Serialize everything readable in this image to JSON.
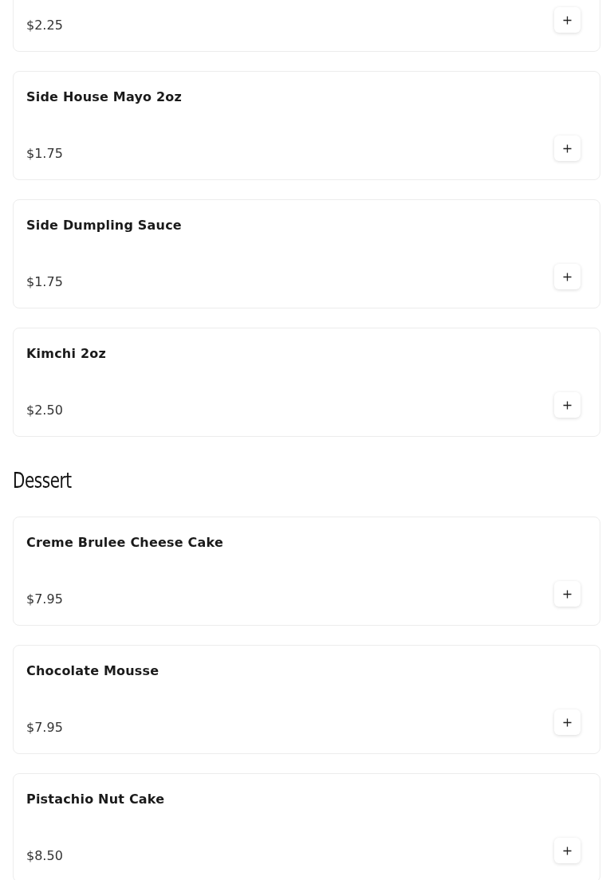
{
  "sections": [
    {
      "items": [
        {
          "price": "$2.25"
        },
        {
          "name": "Side House Mayo 2oz",
          "price": "$1.75"
        },
        {
          "name": "Side Dumpling Sauce",
          "price": "$1.75"
        },
        {
          "name": "Kimchi 2oz",
          "price": "$2.50"
        }
      ]
    },
    {
      "heading": "Dessert",
      "items": [
        {
          "name": "Creme Brulee Cheese Cake",
          "price": "$7.95"
        },
        {
          "name": "Chocolate Mousse",
          "price": "$7.95"
        },
        {
          "name": "Pistachio Nut Cake",
          "price": "$8.50"
        }
      ]
    }
  ]
}
